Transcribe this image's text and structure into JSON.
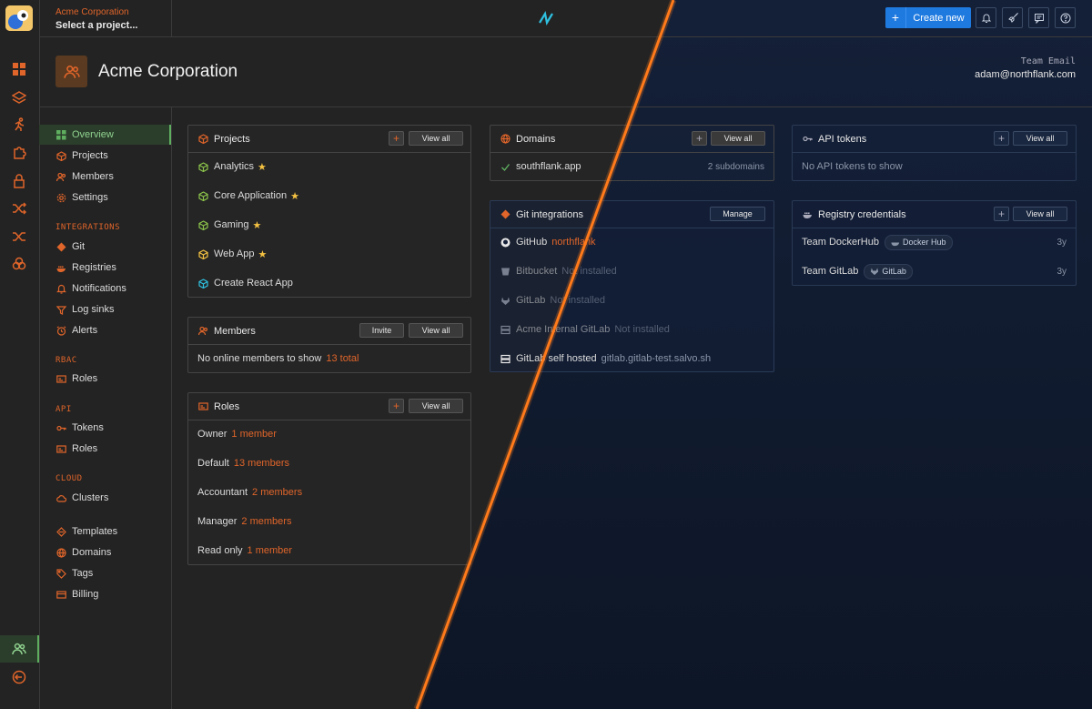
{
  "topbar": {
    "org_name": "Acme Corporation",
    "project_select": "Select a project...",
    "create_new": "Create new"
  },
  "header": {
    "title": "Acme Corporation",
    "team_email_label": "Team Email",
    "team_email_value": "adam@northflank.com"
  },
  "sidebar": {
    "items": [
      {
        "label": "Overview"
      },
      {
        "label": "Projects"
      },
      {
        "label": "Members"
      },
      {
        "label": "Settings"
      }
    ],
    "integrations_title": "INTEGRATIONS",
    "integrations": [
      {
        "label": "Git"
      },
      {
        "label": "Registries"
      },
      {
        "label": "Notifications"
      },
      {
        "label": "Log sinks"
      },
      {
        "label": "Alerts"
      }
    ],
    "rbac_title": "RBAC",
    "rbac": [
      {
        "label": "Roles"
      }
    ],
    "api_title": "API",
    "api": [
      {
        "label": "Tokens"
      },
      {
        "label": "Roles"
      }
    ],
    "cloud_title": "CLOUD",
    "cloud": [
      {
        "label": "Clusters"
      }
    ],
    "other": [
      {
        "label": "Templates"
      },
      {
        "label": "Domains"
      },
      {
        "label": "Tags"
      },
      {
        "label": "Billing"
      }
    ]
  },
  "projects_card": {
    "title": "Projects",
    "view_all": "View all",
    "items": [
      {
        "name": "Analytics",
        "starred": "★"
      },
      {
        "name": "Core Application",
        "starred": "★"
      },
      {
        "name": "Gaming",
        "starred": "★"
      },
      {
        "name": "Web App",
        "starred": "★"
      },
      {
        "name": "Create React App"
      }
    ]
  },
  "members_card": {
    "title": "Members",
    "invite": "Invite",
    "view_all": "View all",
    "empty_text": "No online members to show",
    "total": "13 total"
  },
  "roles_card": {
    "title": "Roles",
    "view_all": "View all",
    "items": [
      {
        "name": "Owner",
        "count": "1 member"
      },
      {
        "name": "Default",
        "count": "13 members"
      },
      {
        "name": "Accountant",
        "count": "2 members"
      },
      {
        "name": "Manager",
        "count": "2 members"
      },
      {
        "name": "Read only",
        "count": "1 member"
      }
    ]
  },
  "domains_card": {
    "title": "Domains",
    "view_all": "View all",
    "items": [
      {
        "name": "southflank.app",
        "subdomains": "2 subdomains"
      }
    ]
  },
  "git_card": {
    "title": "Git integrations",
    "manage": "Manage",
    "items": [
      {
        "name": "GitHub",
        "status": "northflank"
      },
      {
        "name": "Bitbucket",
        "status": "Not installed"
      },
      {
        "name": "GitLab",
        "status": "Not installed"
      },
      {
        "name": "Acme Internal GitLab",
        "status": "Not installed"
      },
      {
        "name": "GitLab self hosted",
        "status": "gitlab.gitlab-test.salvo.sh"
      }
    ]
  },
  "api_tokens_card": {
    "title": "API tokens",
    "view_all": "View all",
    "empty_text": "No API tokens to show"
  },
  "registry_card": {
    "title": "Registry credentials",
    "view_all": "View all",
    "items": [
      {
        "name": "Team DockerHub",
        "chip": "Docker Hub",
        "age": "3y"
      },
      {
        "name": "Team GitLab",
        "chip": "GitLab",
        "age": "3y"
      }
    ]
  },
  "colors": {
    "accent": "#e0652a",
    "primary_button": "#1f7ae0",
    "active_nav": "#5fae5f",
    "star": "#f5c242",
    "divider_line": "#ff7a1a"
  }
}
